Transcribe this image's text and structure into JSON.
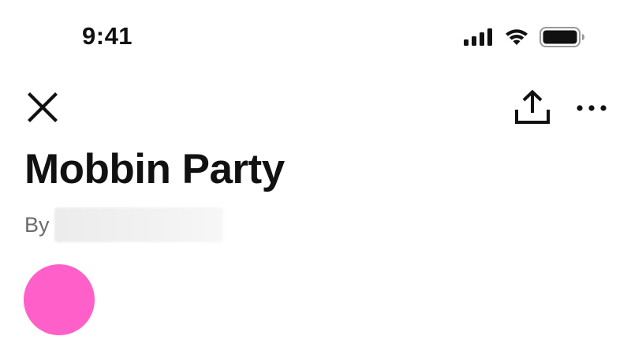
{
  "status_bar": {
    "time": "9:41",
    "icons": [
      "cellular-signal-icon",
      "wifi-icon",
      "battery-icon"
    ]
  },
  "toolbar": {
    "close_icon": "close-icon",
    "share_icon": "share-upload-icon",
    "more_icon": "more-horizontal-icon"
  },
  "party": {
    "title": "Mobbin Party",
    "by_label": "By",
    "avatar_color": "#FF5FC9"
  },
  "colors": {
    "text_primary": "#111111",
    "text_secondary": "#6b6b6b",
    "background": "#ffffff"
  }
}
